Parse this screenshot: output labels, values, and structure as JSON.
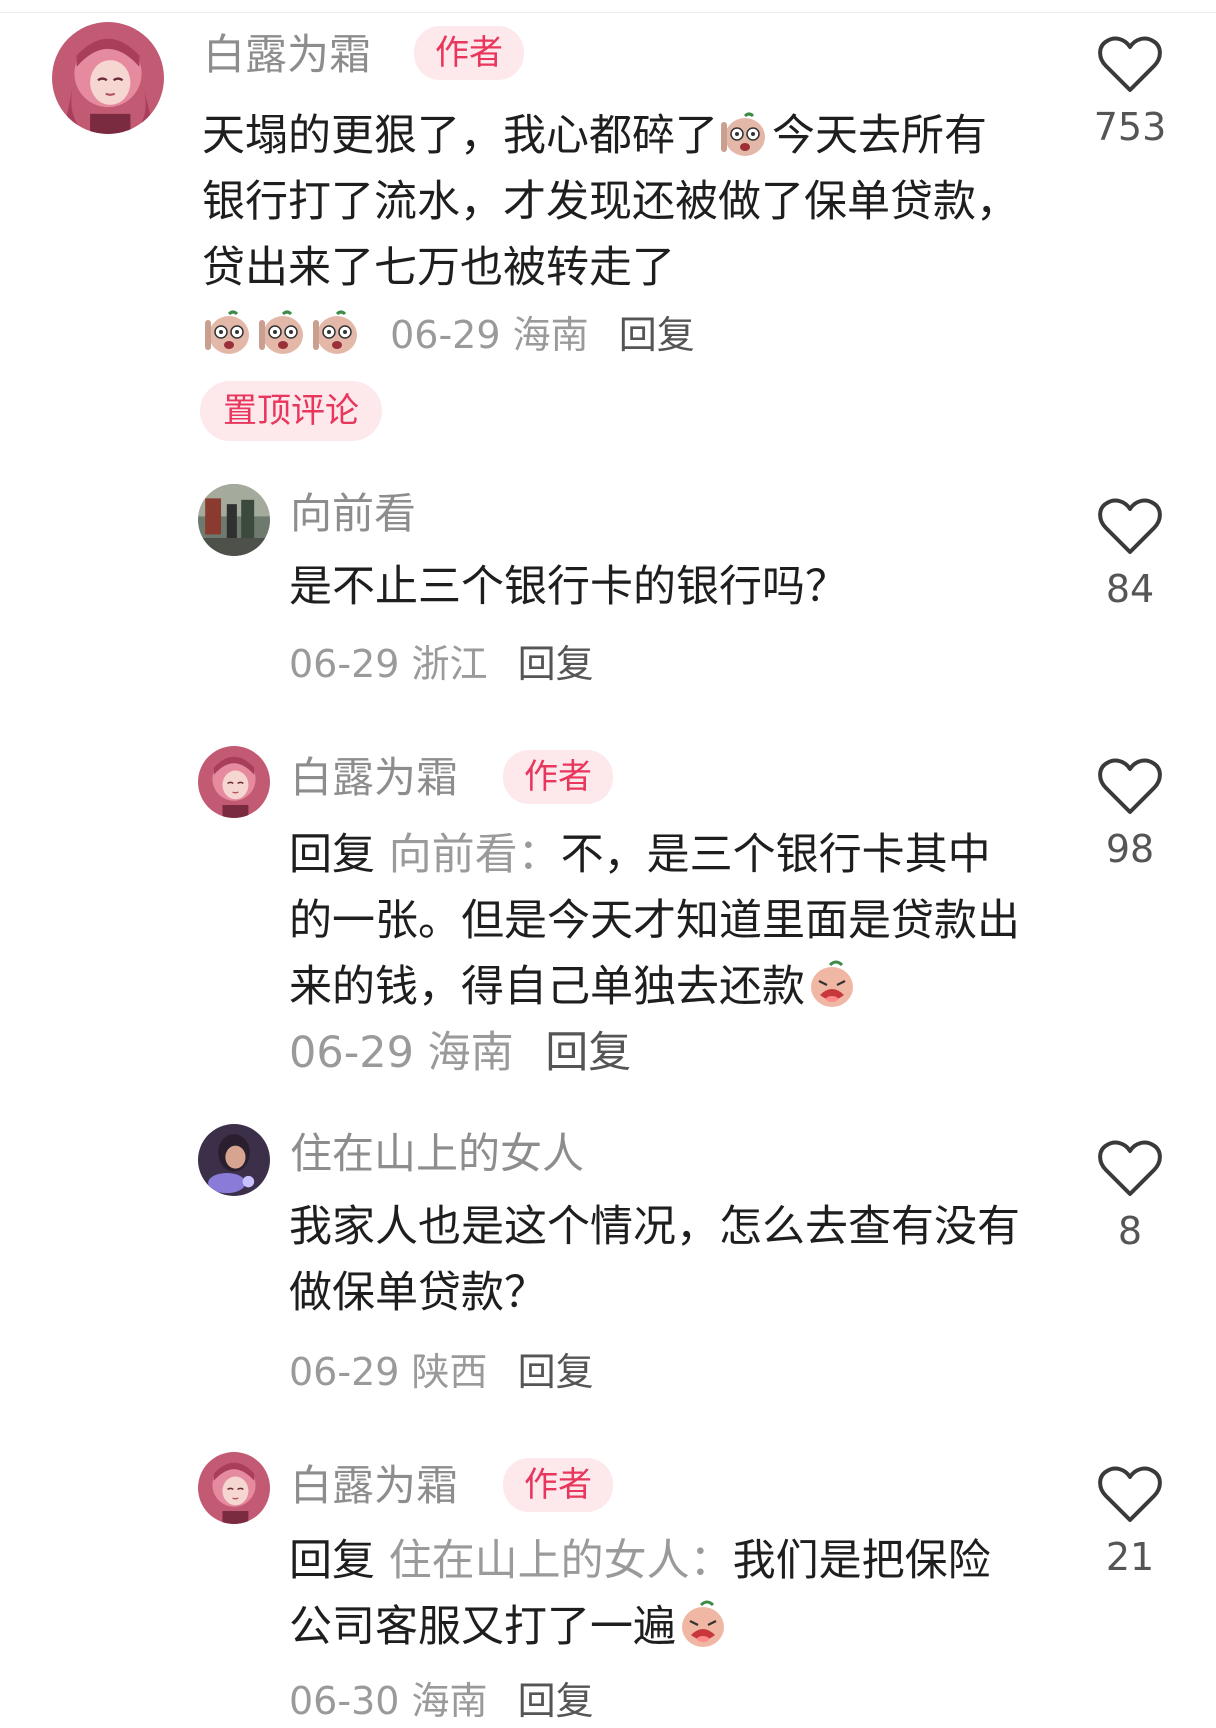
{
  "comments": [
    {
      "author": "白露为霜",
      "badge": "作者",
      "text_before_emoji": "天塌的更狠了，我心都碎了",
      "text_after_emoji": "今天去所有银行打了流水，才发现还被做了保单贷款，贷出来了七万也被转走了",
      "date": "06-29",
      "location": "海南",
      "reply_label": "回复",
      "pin_label": "置顶评论",
      "likes": "753",
      "avatar_icon": "anime-girl-avatar",
      "emoji_icon": "shocked-peanut-emoji"
    },
    {
      "author": "向前看",
      "text": "是不止三个银行卡的银行吗？",
      "date": "06-29",
      "location": "浙江",
      "reply_label": "回复",
      "likes": "84",
      "avatar_icon": "street-photo-avatar"
    },
    {
      "author": "白露为霜",
      "badge": "作者",
      "reply_prefix": "回复",
      "reply_target": "向前看：",
      "text": "不，是三个银行卡其中的一张。但是今天才知道里面是贷款出来的钱，得自己单独去还款",
      "date": "06-29",
      "location": "海南",
      "reply_label": "回复",
      "likes": "98",
      "avatar_icon": "anime-girl-avatar",
      "emoji_icon": "crying-peanut-emoji"
    },
    {
      "author": "住在山上的女人",
      "text": "我家人也是这个情况，怎么去查有没有做保单贷款？",
      "date": "06-29",
      "location": "陕西",
      "reply_label": "回复",
      "likes": "8",
      "avatar_icon": "night-portrait-avatar"
    },
    {
      "author": "白露为霜",
      "badge": "作者",
      "reply_prefix": "回复",
      "reply_target": "住在山上的女人：",
      "text": "我们是把保险公司客服又打了一遍",
      "date": "06-30",
      "location": "海南",
      "reply_label": "回复",
      "likes": "21",
      "avatar_icon": "anime-girl-avatar",
      "emoji_icon": "crying-peanut-emoji"
    }
  ],
  "colors": {
    "badge_bg": "#fde8ec",
    "badge_text": "#e8365c",
    "name": "#8d8d8d",
    "meta": "#9a9a9a",
    "heart_stroke": "#3a3a3a"
  },
  "icons": {
    "like": "heart-outline-icon"
  }
}
